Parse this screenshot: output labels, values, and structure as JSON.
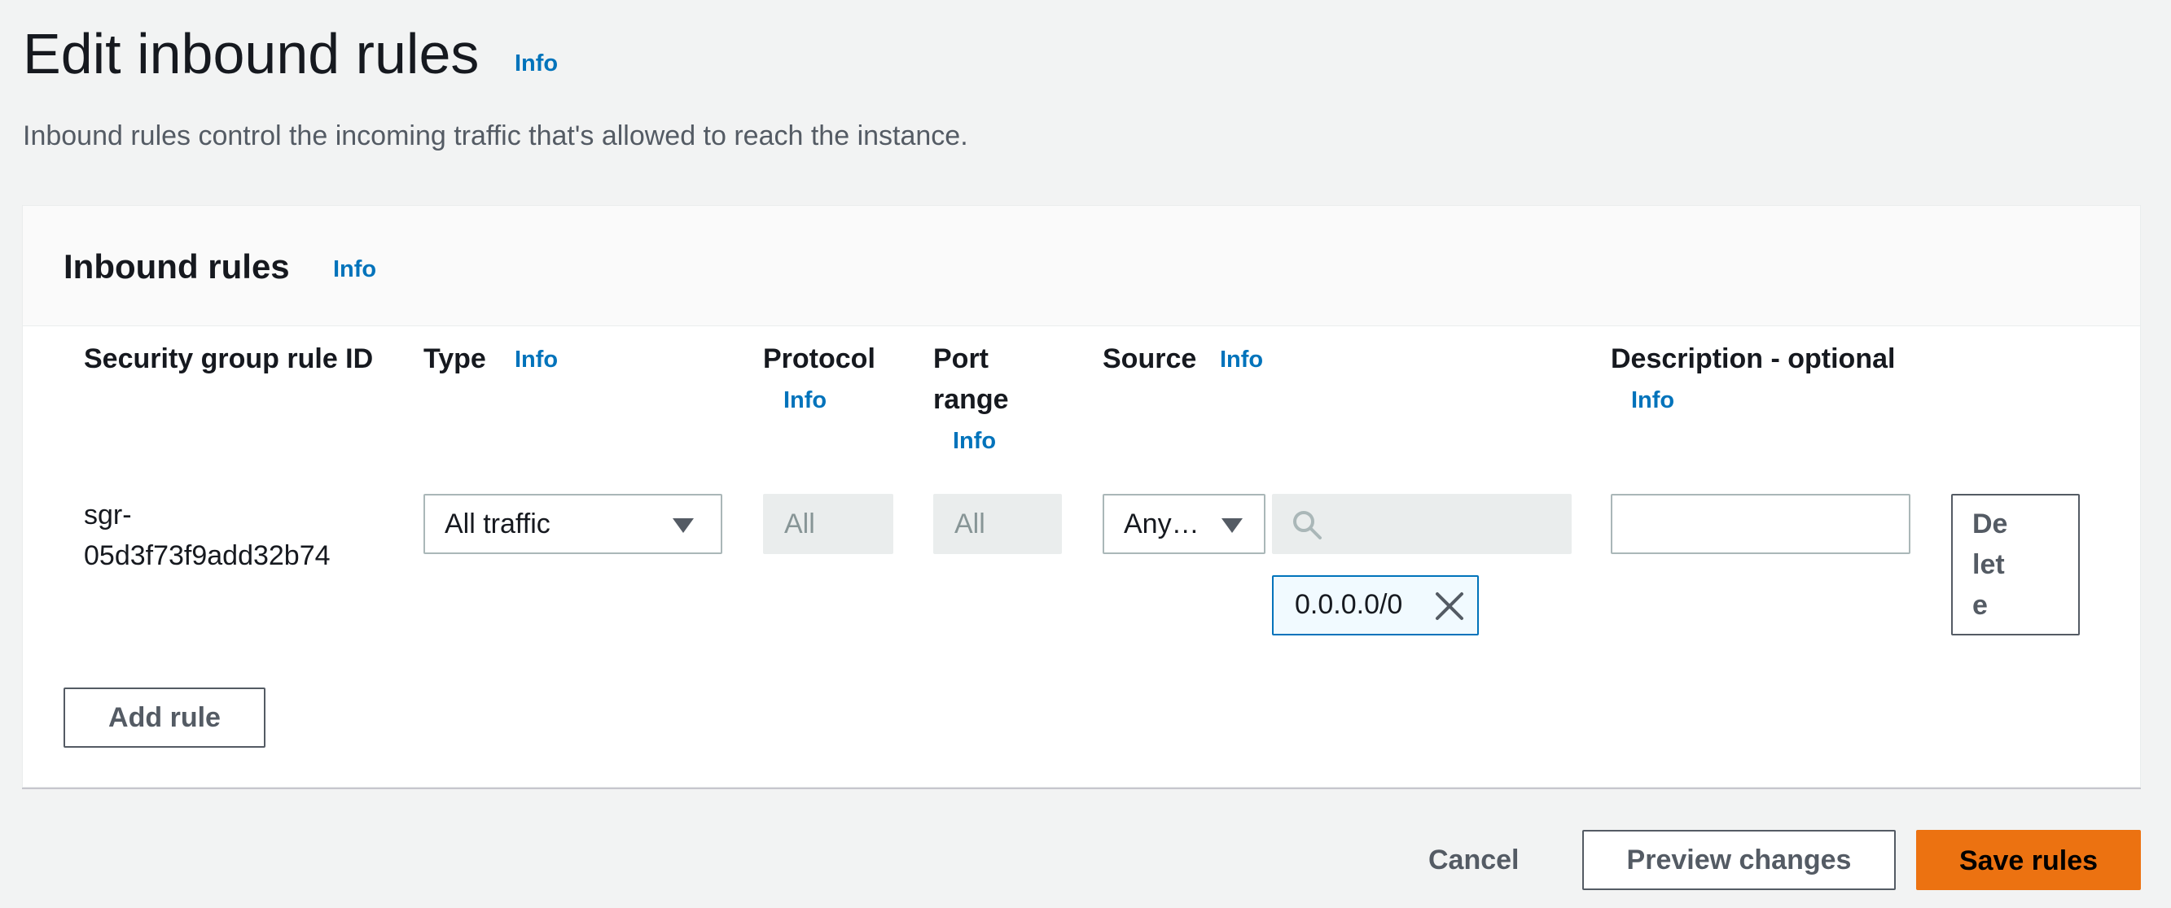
{
  "page": {
    "title": "Edit inbound rules",
    "title_info": "Info",
    "description": "Inbound rules control the incoming traffic that's allowed to reach the instance."
  },
  "panel": {
    "title": "Inbound rules",
    "title_info": "Info",
    "columns": {
      "rule_id": "Security group rule ID",
      "type": "Type",
      "type_info": "Info",
      "protocol": "Protocol",
      "protocol_info": "Info",
      "port_range_line1": "Port",
      "port_range_line2": "range",
      "port_range_info": "Info",
      "source": "Source",
      "source_info": "Info",
      "description": "Description - optional",
      "description_info": "Info"
    },
    "rules": [
      {
        "rule_id_line1": "sgr-",
        "rule_id_line2": "05d3f73f9add32b74",
        "type": "All traffic",
        "protocol": "All",
        "port_range": "All",
        "source_type": "Any…",
        "source_search_value": "",
        "source_token": "0.0.0.0/0",
        "description_value": "",
        "delete_line1": "De",
        "delete_line2": "let",
        "delete_line3": "e"
      }
    ],
    "add_rule_label": "Add rule"
  },
  "footer": {
    "cancel_label": "Cancel",
    "preview_label": "Preview changes",
    "save_label": "Save rules"
  },
  "colors": {
    "accent_link": "#0073bb",
    "primary_button": "#ec7211",
    "background": "#f2f3f3"
  },
  "icons": {
    "dropdown": "caret-down-icon",
    "search": "search-icon",
    "token_remove": "close-icon"
  }
}
